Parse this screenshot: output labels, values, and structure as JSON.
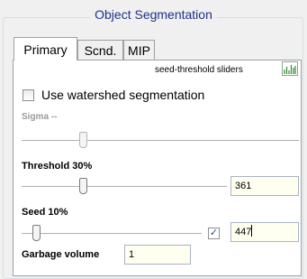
{
  "group": {
    "title": "Object Segmentation"
  },
  "tabs": [
    {
      "label": "Primary",
      "active": true
    },
    {
      "label": "Scnd.",
      "active": false
    },
    {
      "label": "MIP",
      "active": false
    }
  ],
  "primary": {
    "header_link": "seed-threshold sliders",
    "header_icon": "histogram-icon",
    "watershed": {
      "label": "Use watershed segmentation",
      "checked": false
    },
    "sigma": {
      "label": "Sigma --",
      "enabled": false,
      "slider_fraction": 0.22
    },
    "threshold": {
      "label": "Threshold",
      "percent": "30%",
      "value": "361",
      "slider_fraction": 0.3
    },
    "seed": {
      "label": "Seed",
      "percent": "10%",
      "value": "447",
      "checked": true,
      "slider_fraction": 0.08
    },
    "garbage": {
      "label": "Garbage volume",
      "value": "1"
    }
  },
  "colors": {
    "title": "#1e3287",
    "field_bg": "#fffff0",
    "panel_bg": "#ffffff",
    "window_bg": "#f0f0f0"
  }
}
